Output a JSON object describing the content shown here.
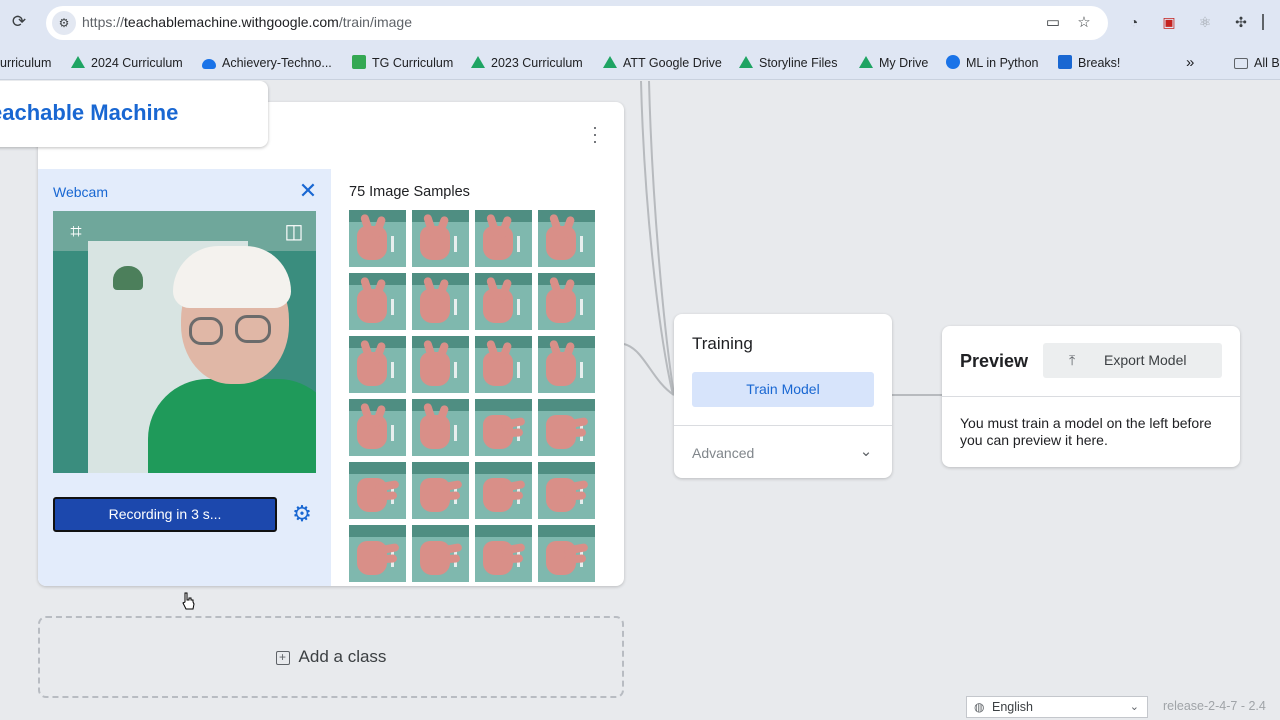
{
  "browser": {
    "url_prefix": "https://",
    "url_host": "teachablemachine.withgoogle.com",
    "url_path": "/train/image"
  },
  "bookmarks": [
    {
      "label": "urriculum",
      "icon": "none"
    },
    {
      "label": "2024 Curriculum",
      "icon": "google-drive-icon"
    },
    {
      "label": "Achievery-Techno...",
      "icon": "cloud-icon"
    },
    {
      "label": "TG Curriculum",
      "icon": "tg-icon"
    },
    {
      "label": "2023 Curriculum",
      "icon": "google-drive-icon"
    },
    {
      "label": "ATT Google Drive",
      "icon": "google-drive-icon"
    },
    {
      "label": "Storyline Files",
      "icon": "google-drive-icon"
    },
    {
      "label": "My Drive",
      "icon": "google-drive-icon"
    },
    {
      "label": "ML in Python",
      "icon": "python-icon"
    },
    {
      "label": "Breaks!",
      "icon": "breaks-icon"
    },
    {
      "label": "All B",
      "icon": "folder-icon"
    }
  ],
  "app": {
    "logo_text": "eachable Machine"
  },
  "class_card": {
    "webcam_label": "Webcam",
    "recording_label": "Recording in 3 s...",
    "samples_title": "75 Image Samples",
    "sample_count": 24,
    "sample_kinds": [
      "peace",
      "peace",
      "peace",
      "peace",
      "peace",
      "peace",
      "peace",
      "peace",
      "peace",
      "peace",
      "peace",
      "peace",
      "peace",
      "peace",
      "point",
      "point",
      "point",
      "point",
      "point",
      "point",
      "point",
      "point",
      "point",
      "point"
    ]
  },
  "add_class": {
    "label": "Add a class"
  },
  "training": {
    "title": "Training",
    "train_button": "Train Model",
    "advanced_label": "Advanced"
  },
  "preview": {
    "title": "Preview",
    "export_button": "Export Model",
    "message": "You must train a model on the left before you can preview it here."
  },
  "footer": {
    "language": "English",
    "release": "release-2-4-7 - 2.4"
  }
}
